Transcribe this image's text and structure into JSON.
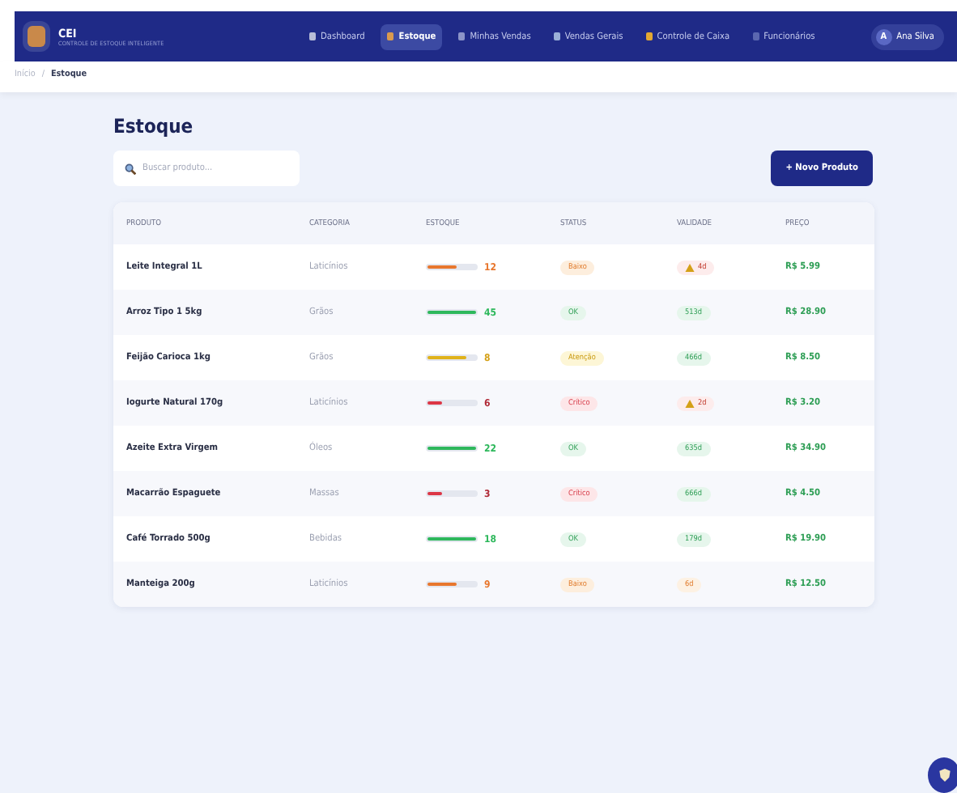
{
  "header": {
    "logo_title": "CEI",
    "logo_subtitle": "CONTROLE DE ESTOQUE INTELIGENTE",
    "nav": [
      {
        "label": "Dashboard",
        "selected": false
      },
      {
        "label": "Estoque",
        "selected": true
      },
      {
        "label": "Minhas Vendas",
        "selected": false
      },
      {
        "label": "Vendas Gerais",
        "selected": false
      },
      {
        "label": "Controle de Caixa",
        "selected": false
      },
      {
        "label": "Funcionários",
        "selected": false
      }
    ],
    "user": {
      "initial": "A",
      "name": "Ana Silva"
    }
  },
  "breadcrumb": [
    "Início",
    "/",
    "Estoque"
  ],
  "title": "Estoque",
  "search": {
    "placeholder": "Buscar produto..."
  },
  "new_button": "+ Novo Produto",
  "table": {
    "columns": [
      "PRODUTO",
      "CATEGORIA",
      "ESTOQUE",
      "STATUS",
      "VALIDADE",
      "PREÇO"
    ],
    "rows": [
      {
        "product": "Leite Integral 1L",
        "category": "Laticínios",
        "level": 0.6,
        "stock": "12",
        "status": "Baixo",
        "kind": "low",
        "expiry": "4d",
        "expiry_warning": true,
        "price": "R$ 5.99"
      },
      {
        "product": "Arroz Tipo 1 5kg",
        "category": "Grãos",
        "level": 1,
        "stock": "45",
        "status": "OK",
        "kind": "ok",
        "expiry": "513d",
        "expiry_warning": false,
        "price": "R$ 28.90"
      },
      {
        "product": "Feijão Carioca 1kg",
        "category": "Grãos",
        "level": 0.8,
        "stock": "8",
        "status": "Atenção",
        "kind": "attention",
        "expiry": "466d",
        "expiry_warning": false,
        "price": "R$ 8.50"
      },
      {
        "product": "Iogurte Natural 170g",
        "category": "Laticínios",
        "level": 0.3,
        "stock": "6",
        "status": "Crítico",
        "kind": "critical",
        "expiry": "2d",
        "expiry_warning": true,
        "price": "R$ 3.20"
      },
      {
        "product": "Azeite Extra Virgem",
        "category": "Óleos",
        "level": 1,
        "stock": "22",
        "status": "OK",
        "kind": "ok",
        "expiry": "635d",
        "expiry_warning": false,
        "price": "R$ 34.90"
      },
      {
        "product": "Macarrão Espaguete",
        "category": "Massas",
        "level": 0.3,
        "stock": "3",
        "status": "Crítico",
        "kind": "critical",
        "expiry": "666d",
        "expiry_warning": false,
        "price": "R$ 4.50"
      },
      {
        "product": "Café Torrado 500g",
        "category": "Bebidas",
        "level": 1,
        "stock": "18",
        "status": "OK",
        "kind": "ok",
        "expiry": "179d",
        "expiry_warning": false,
        "price": "R$ 19.90"
      },
      {
        "product": "Manteiga 200g",
        "category": "Laticínios",
        "level": 0.6,
        "stock": "9",
        "status": "Baixo",
        "kind": "low",
        "expiry": "6d",
        "expiry_warning": false,
        "expiry_near": true,
        "price": "R$ 12.50"
      }
    ]
  }
}
